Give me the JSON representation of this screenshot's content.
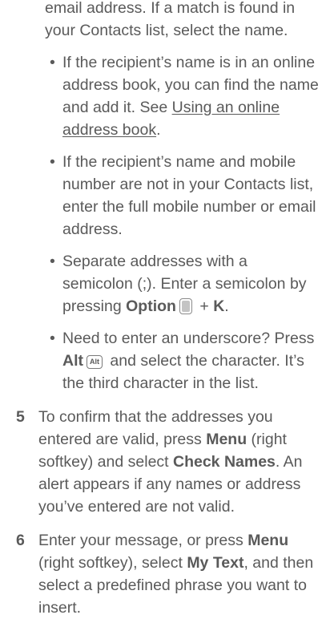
{
  "intro": {
    "line1": "email address. If a match is found in",
    "line2": "your Contacts list, select the name."
  },
  "bullets": [
    {
      "lines": [
        "If the recipient’s name is in an online",
        "address book, you can find the name"
      ],
      "tail_text": "and add it. See ",
      "link_line1": "Using an online ",
      "link_line2": "address book",
      "link_end": "."
    },
    {
      "lines": [
        "If the recipient’s name and mobile",
        "number are not in your Contacts list,",
        "enter the full mobile number or email",
        "address."
      ]
    },
    {
      "line1": "Separate addresses with a",
      "line2": "semicolon (;). Enter a semicolon by",
      "line3_pre": "pressing ",
      "line3_key": "Option",
      "line3_plus": " + ",
      "line3_k": "K",
      "line3_end": ".",
      "key_icon": "option-key-icon"
    },
    {
      "line1": "Need to enter an underscore? Press",
      "line2_key": "Alt",
      "line2_icon_label": "Alt",
      "line2_post": " and select the character. It’s",
      "line3": "the third character in the list.",
      "key_icon": "alt-key-icon"
    }
  ],
  "steps": [
    {
      "number": "5",
      "line1": "To confirm that the addresses you",
      "line2_pre": "entered are valid, press ",
      "line2_bold": "Menu",
      "line2_post": " (right",
      "line3_pre": "softkey) and select ",
      "line3_bold": "Check Names",
      "line3_post": ". An",
      "line4": "alert appears if any names or address",
      "line5": "you’ve entered are not valid."
    },
    {
      "number": "6",
      "line1_pre": "Enter your message, or press ",
      "line1_bold": "Menu",
      "line2_pre": "(right softkey), select ",
      "line2_bold": "My Text",
      "line2_post": ", and then",
      "line3": "select a predefined phrase you want to",
      "line4": "insert."
    }
  ]
}
